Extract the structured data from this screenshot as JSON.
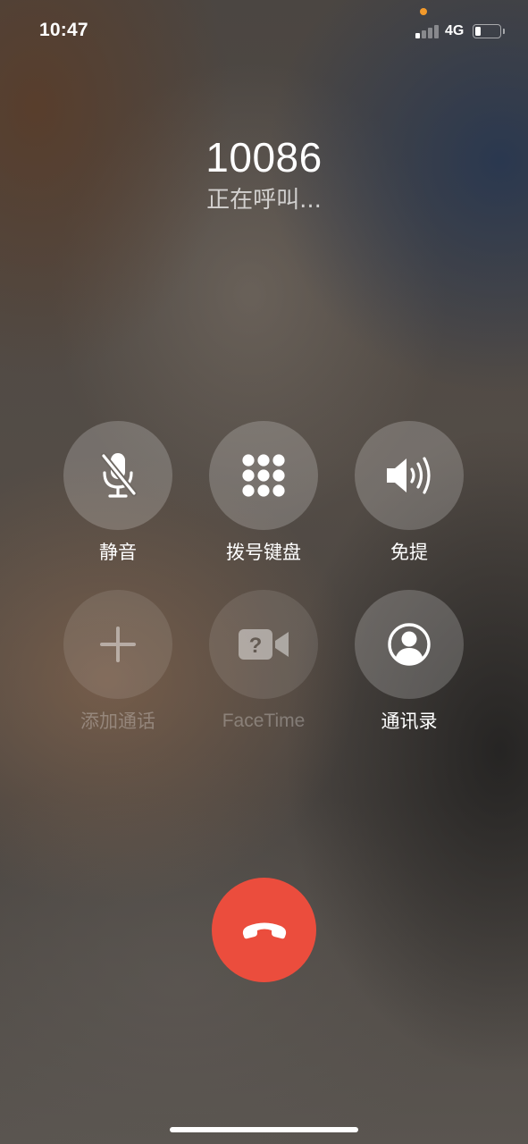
{
  "status_bar": {
    "time": "10:47",
    "network": "4G",
    "signal_bars_active": 1,
    "battery_level_fraction": 0.25,
    "privacy_indicator_color": "#f39a2b"
  },
  "caller": {
    "number": "10086",
    "status": "正在呼叫..."
  },
  "controls": {
    "mute": {
      "label": "静音",
      "icon": "mic-slash-icon",
      "enabled": true
    },
    "keypad": {
      "label": "拨号键盘",
      "icon": "keypad-icon",
      "enabled": true
    },
    "speaker": {
      "label": "免提",
      "icon": "speaker-icon",
      "enabled": true
    },
    "add_call": {
      "label": "添加通话",
      "icon": "plus-icon",
      "enabled": false
    },
    "facetime": {
      "label": "FaceTime",
      "icon": "video-question-icon",
      "enabled": false
    },
    "contacts": {
      "label": "通讯录",
      "icon": "person-circle-icon",
      "enabled": true
    }
  },
  "end_call": {
    "icon": "phone-hangup-icon",
    "color": "#eb4d3d"
  }
}
